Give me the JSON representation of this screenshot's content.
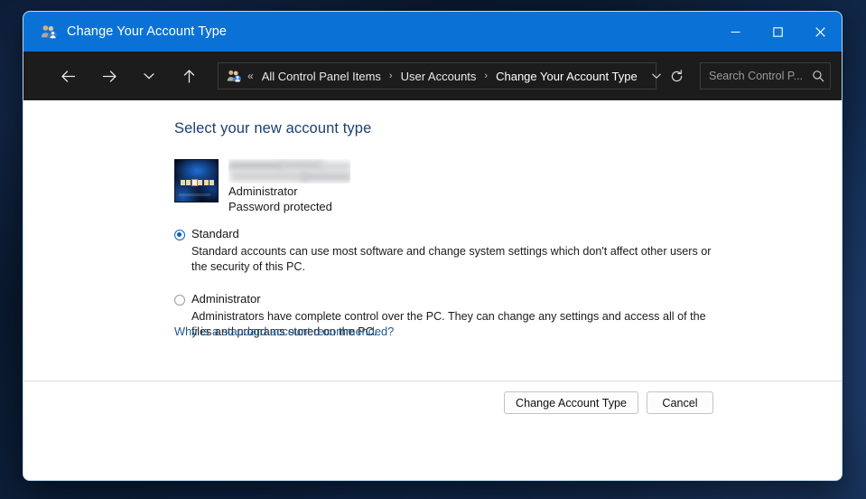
{
  "window": {
    "title": "Change Your Account Type",
    "title_icon": "user-accounts-icon",
    "controls": {
      "minimize": "Minimize",
      "maximize": "Maximize",
      "close": "Close"
    }
  },
  "navbar": {
    "back": "Back",
    "forward": "Forward",
    "recent": "Recent locations",
    "up": "Up one level",
    "refresh": "Refresh",
    "breadcrumb": {
      "icon": "user-accounts-icon",
      "overflow": "«",
      "items": [
        {
          "label": "All Control Panel Items"
        },
        {
          "label": "User Accounts"
        },
        {
          "label": "Change Your Account Type"
        }
      ],
      "separator": "›",
      "dropdown": "Previous locations"
    },
    "search": {
      "placeholder": "Search Control P...",
      "value": "",
      "icon": "search-icon"
    }
  },
  "content": {
    "heading": "Select your new account type",
    "account": {
      "picture_alt": "account-picture",
      "name_redacted": true,
      "type": "Administrator",
      "password_state": "Password protected"
    },
    "options": [
      {
        "id": "standard",
        "label": "Standard",
        "selected": true,
        "description": "Standard accounts can use most software and change system settings which don't affect other users or the security of this PC."
      },
      {
        "id": "administrator",
        "label": "Administrator",
        "selected": false,
        "description": "Administrators have complete control over the PC. They can change any settings and access all of the files and programs stored on the PC."
      }
    ],
    "help_link": "Why is a standard account recommended?"
  },
  "footer": {
    "primary_button": "Change Account Type",
    "secondary_button": "Cancel"
  },
  "colors": {
    "titlebar": "#0a72d6",
    "navbar": "#1c1c1c",
    "heading": "#1c3f72",
    "link": "#20578f",
    "accent_radio": "#0a62c2"
  }
}
